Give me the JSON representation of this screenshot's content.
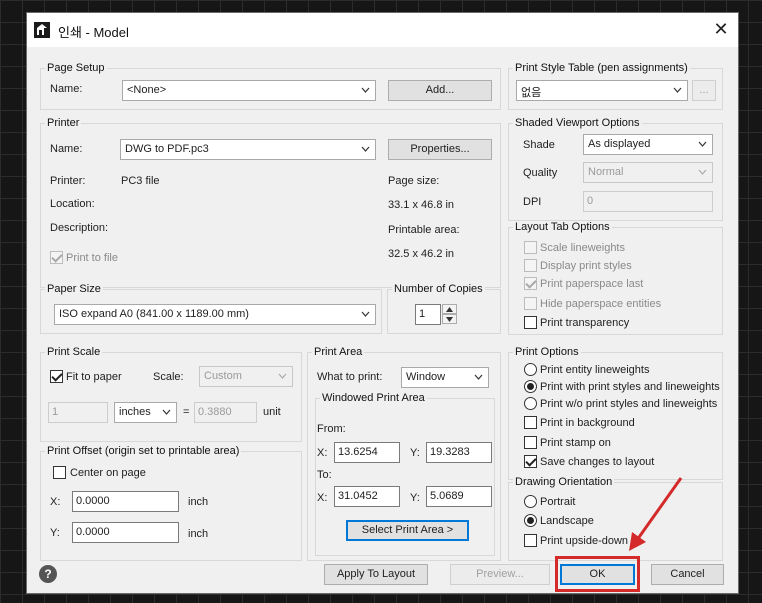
{
  "title": "인쇄 - Model",
  "page_setup": {
    "legend": "Page Setup",
    "name_label": "Name:",
    "name_value": "<None>",
    "add_label": "Add..."
  },
  "printer": {
    "legend": "Printer",
    "name_label": "Name:",
    "name_value": "DWG to PDF.pc3",
    "properties_label": "Properties...",
    "printer_label": "Printer:",
    "printer_value": "PC3 file",
    "location_label": "Location:",
    "description_label": "Description:",
    "page_size_label": "Page size:",
    "page_size_value": "33.1 x 46.8 in",
    "printable_label": "Printable area:",
    "printable_value": "32.5 x 46.2 in",
    "print_to_file_label": "Print to file",
    "print_to_file_checked": true
  },
  "paper_size": {
    "legend": "Paper Size",
    "value": "ISO expand A0 (841.00 x 1189.00 mm)"
  },
  "copies": {
    "legend": "Number of Copies",
    "value": "1"
  },
  "print_scale": {
    "legend": "Print Scale",
    "fit_label": "Fit to paper",
    "fit_checked": true,
    "scale_label": "Scale:",
    "scale_value": "Custom",
    "first_value": "1",
    "unit_value": "inches",
    "equals": "=",
    "second_value": "0.3880",
    "unit_label": "unit"
  },
  "print_offset": {
    "legend": "Print Offset (origin set to printable area)",
    "center_label": "Center on page",
    "center_checked": false,
    "x_label": "X:",
    "x_value": "0.0000",
    "y_label": "Y:",
    "y_value": "0.0000",
    "unit": "inch"
  },
  "print_area": {
    "legend": "Print Area",
    "what_label": "What to print:",
    "what_value": "Window",
    "windowed_legend": "Windowed Print Area",
    "from_label": "From:",
    "from_x_label": "X:",
    "from_x": "13.6254",
    "from_y_label": "Y:",
    "from_y": "19.3283",
    "to_label": "To:",
    "to_x_label": "X:",
    "to_x": "31.0452",
    "to_y_label": "Y:",
    "to_y": "5.0689",
    "select_label": "Select Print Area >"
  },
  "print_style": {
    "legend": "Print Style Table (pen assignments)",
    "value": "없음",
    "edit_label": "..."
  },
  "shaded": {
    "legend": "Shaded Viewport Options",
    "shade_label": "Shade",
    "shade_value": "As displayed",
    "quality_label": "Quality",
    "quality_value": "Normal",
    "dpi_label": "DPI",
    "dpi_value": "0"
  },
  "layout_tab": {
    "legend": "Layout Tab Options",
    "items": [
      {
        "label": "Scale lineweights",
        "checked": false,
        "enabled": false
      },
      {
        "label": "Display print styles",
        "checked": false,
        "enabled": false
      },
      {
        "label": "Print paperspace last",
        "checked": true,
        "enabled": false
      },
      {
        "label": "Hide paperspace entities",
        "checked": false,
        "enabled": false
      },
      {
        "label": "Print transparency",
        "checked": false,
        "enabled": true
      }
    ]
  },
  "print_options": {
    "legend": "Print Options",
    "radios": [
      {
        "label": "Print entity lineweights",
        "checked": false
      },
      {
        "label": "Print with print styles and lineweights",
        "checked": true
      },
      {
        "label": "Print w/o print styles and lineweights",
        "checked": false
      }
    ],
    "checks": [
      {
        "label": "Print in background",
        "checked": false
      },
      {
        "label": "Print stamp on",
        "checked": false
      },
      {
        "label": "Save changes to layout",
        "checked": true
      }
    ]
  },
  "orientation": {
    "legend": "Drawing Orientation",
    "portrait_label": "Portrait",
    "landscape_label": "Landscape",
    "upside_label": "Print upside-down",
    "selected": "landscape",
    "upside_checked": false
  },
  "footer": {
    "help": "?",
    "apply_label": "Apply To Layout",
    "preview_label": "Preview...",
    "ok_label": "OK",
    "cancel_label": "Cancel"
  },
  "colors": {
    "highlight": "#d42a2a",
    "focus": "#0078d7",
    "dialog_bg": "#f0f0f0"
  },
  "icons": {
    "app": "app-logo-icon",
    "close": "close-icon",
    "help": "help-icon",
    "dropdown": "chevron-down-icon",
    "pointer": "red-arrow-annotation"
  }
}
